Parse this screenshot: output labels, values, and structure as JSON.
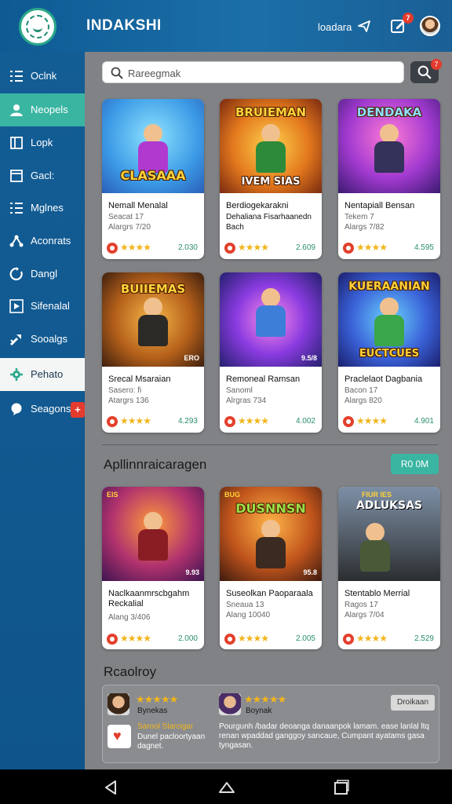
{
  "topbar": {
    "title": "INDAKSHI",
    "link_label": "loadara",
    "notification_count": "7"
  },
  "sidebar": {
    "items": [
      {
        "label": "Oclnk",
        "icon": "grid-icon"
      },
      {
        "label": "Neopels",
        "icon": "user-icon"
      },
      {
        "label": "Lopk",
        "icon": "book-icon"
      },
      {
        "label": "Gacl:",
        "icon": "window-icon"
      },
      {
        "label": "Mglnes",
        "icon": "grid-icon"
      },
      {
        "label": "Aconrats",
        "icon": "share-icon"
      },
      {
        "label": "Dangl",
        "icon": "refresh-icon"
      },
      {
        "label": "Sifenalal",
        "icon": "play-icon"
      },
      {
        "label": "Sooalgs",
        "icon": "tool-icon"
      },
      {
        "label": "Pehato",
        "icon": "gear-icon"
      },
      {
        "label": "Seagons",
        "icon": "chat-icon",
        "badge": "+"
      }
    ]
  },
  "search": {
    "placeholder": "Rareegmak",
    "badge": "7"
  },
  "games": [
    {
      "art_title": "CLASAAA",
      "name": "Nemall Menalal",
      "line2": "Seacat 17",
      "line3": "Alargrs 7/20",
      "score": "2.030",
      "stars": "★★★★"
    },
    {
      "art_title": "BRUIEMAN",
      "art_sub": "IVEM SIAS",
      "name": "Berdiogekarakni",
      "line2": "Dehaliana Fisarhaanedn",
      "line3": "Bach",
      "score": "2.609",
      "stars": "★★★★"
    },
    {
      "art_title": "DENDAKA",
      "name": "Nentapiall Bensan",
      "line2": "Tekem 7",
      "line3": "Alargs 7/82",
      "score": "4.595",
      "stars": "★★★★"
    },
    {
      "art_title": "BUIIEMAS",
      "art_tag": "ERO",
      "name": "Srecal Msaraian",
      "line2": "Sasero: fi",
      "line3": "Atargrs 136",
      "score": "4.293",
      "stars": "★★★★"
    },
    {
      "art_title": "",
      "art_tag": "9.5/8",
      "name": "Remoneal Ramsan",
      "line2": "Sanoml",
      "line3": "Alrgras 734",
      "score": "4.002",
      "stars": "★★★★"
    },
    {
      "art_title": "KUERAANIAN",
      "art_sub": "EUCTCUES",
      "name": "Praclelaot Dagbania",
      "line2": "Bacon 17",
      "line3": "Alargs 820",
      "score": "4.901",
      "stars": "★★★★"
    },
    {
      "art_title": "",
      "art_tag": "EIS",
      "art_tag2": "9.93",
      "name": "Naclkaanmrscbgahm Reckalial",
      "line2": "",
      "line3": "Alang 3/406",
      "score": "2.000",
      "stars": "★★★★"
    },
    {
      "art_title": "DUSNNSN",
      "art_tag": "BUG",
      "art_tag2": "95.8",
      "name": "Suseolkan Paoparaala",
      "line2": "Sneaua 13",
      "line3": "Alang 10040",
      "score": "2.005",
      "stars": "★★★★"
    },
    {
      "art_title": "ADLUKSAS",
      "art_tag": "FIUR IES",
      "name": "Stentablo Merrial",
      "line2": "Ragos 17",
      "line3": "Alargs 7/04",
      "score": "2.529",
      "stars": "★★★★"
    }
  ],
  "section": {
    "title": "Apllinnraicaragen",
    "button_label": "R0 0M"
  },
  "recommended": {
    "title": "Rcaolroy",
    "button_label": "Droikaan",
    "reviews": [
      {
        "name": "Bynekas",
        "stars": "★★★★★",
        "text_highlight": "Sarool Slarcigar",
        "text": "Dunel pacloortyaan dagnet."
      },
      {
        "name": "Boynak",
        "stars": "★★★★★",
        "text": "Pourgunh /badar deoanga danaanpok lamam. ease lanlal ltq renan wpaddad ganggoy sancaue, Cumpant ayatams gasa tyngasan."
      }
    ]
  },
  "colors": {
    "header": "#1b6fa8",
    "sidebar": "#135d95",
    "accent": "#3ab5a2",
    "badge": "#e33b2e",
    "star": "#f2b51b"
  }
}
